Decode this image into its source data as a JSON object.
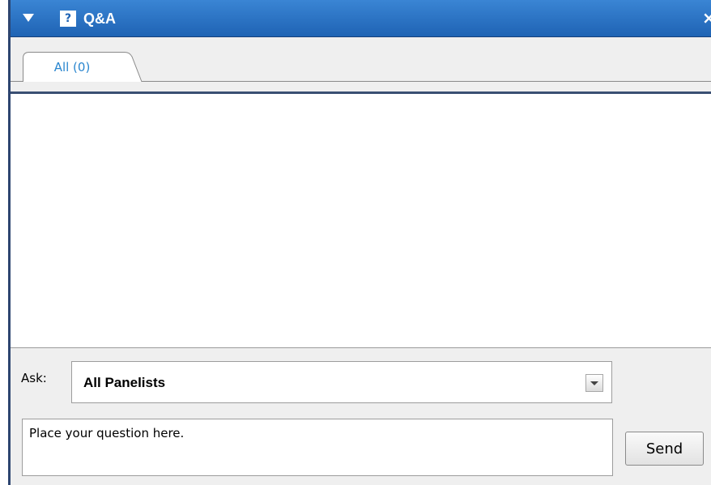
{
  "titlebar": {
    "title": "Q&A",
    "collapse_icon": "triangle-down-icon",
    "help_icon_glyph": "?",
    "close_glyph": "×"
  },
  "tabs": [
    {
      "label": "All (0)",
      "selected": true
    }
  ],
  "ask": {
    "label": "Ask:",
    "selected": "All Panelists"
  },
  "question": {
    "placeholder": "Place your question here.",
    "value": ""
  },
  "send": {
    "label": "Send"
  },
  "colors": {
    "titlebar_top": "#3a85d4",
    "titlebar_bottom": "#1f63b4",
    "tab_text": "#2a86cf",
    "panel_bg": "#efefef"
  }
}
